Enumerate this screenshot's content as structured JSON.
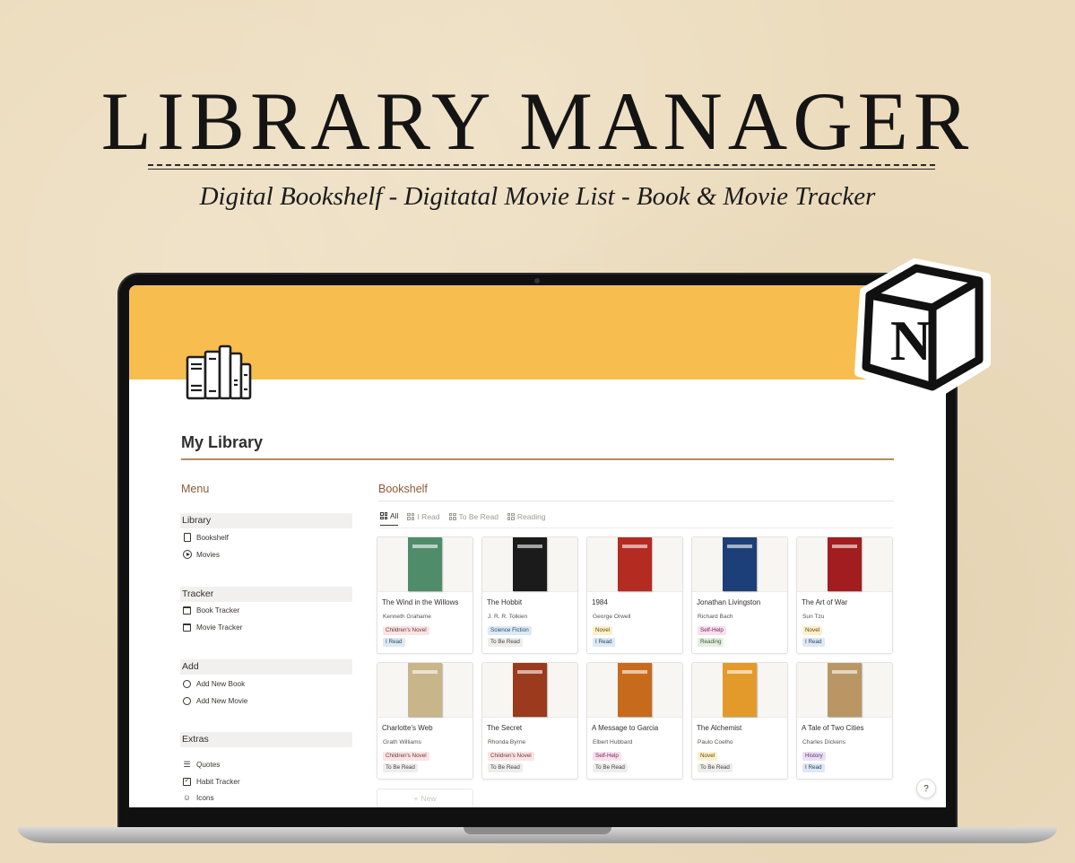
{
  "hero": {
    "title": "LIBRARY MANAGER",
    "subtitle": "Digital Bookshelf - Digitatal Movie List  - Book & Movie Tracker"
  },
  "notion_logo": {
    "letter": "N"
  },
  "colors": {
    "cover": "#f7bd4e",
    "accent_brown": "#8c5a3a",
    "tags": {
      "children": {
        "bg": "#fbe4e4",
        "fg": "#6b3a3a"
      },
      "novel": {
        "bg": "#fbf0c9",
        "fg": "#5c4a1e"
      },
      "science": {
        "bg": "#dbeaf6",
        "fg": "#2e4c66"
      },
      "selfhelp": {
        "bg": "#f9e0ef",
        "fg": "#6b2c51"
      },
      "history": {
        "bg": "#ecdff5",
        "fg": "#533565"
      },
      "iread": {
        "bg": "#dde9f3",
        "fg": "#2a4a63"
      },
      "toberead": {
        "bg": "#eeedeb",
        "fg": "#45433f"
      },
      "reading": {
        "bg": "#e3f0e0",
        "fg": "#3b5a35"
      }
    }
  },
  "page": {
    "icon": "books-icon",
    "title": "My Library"
  },
  "sidebar": {
    "heading": "Menu",
    "sections": [
      {
        "label": "Library",
        "items": [
          {
            "label": "Bookshelf",
            "icon": "book-icon"
          },
          {
            "label": "Movies",
            "icon": "play-icon"
          }
        ]
      },
      {
        "label": "Tracker",
        "items": [
          {
            "label": "Book Tracker",
            "icon": "calendar-icon"
          },
          {
            "label": "Movie Tracker",
            "icon": "calendar-icon"
          }
        ]
      },
      {
        "label": "Add",
        "items": [
          {
            "label": "Add New Book",
            "icon": "circle-icon"
          },
          {
            "label": "Add New Movie",
            "icon": "circle-icon"
          }
        ]
      },
      {
        "label": "Extras",
        "items": [
          {
            "label": "Quotes",
            "icon": "list-icon"
          },
          {
            "label": "Habit Tracker",
            "icon": "checkbox-icon"
          },
          {
            "label": "Icons",
            "icon": "smile-icon"
          }
        ]
      }
    ]
  },
  "bookshelf": {
    "heading": "Bookshelf",
    "tabs": [
      "All",
      "I Read",
      "To Be Read",
      "Reading"
    ],
    "active_tab": "All",
    "new_label": "New",
    "help_label": "?",
    "books": [
      {
        "title": "The Wind in the Willows",
        "author": "Kenneth Grahame",
        "genre": "Children's Novel",
        "genre_key": "children",
        "status": "I Read",
        "status_key": "iread",
        "cover": "#4f8d6a"
      },
      {
        "title": "The Hobbit",
        "author": "J. R. R. Tolkien",
        "genre": "Science Fiction",
        "genre_key": "science",
        "status": "To Be Read",
        "status_key": "toberead",
        "cover": "#1b1b1b"
      },
      {
        "title": "1984",
        "author": "George Orwell",
        "genre": "Novel",
        "genre_key": "novel",
        "status": "I Read",
        "status_key": "iread",
        "cover": "#b42b22"
      },
      {
        "title": "Jonathan Livingston",
        "author": "Richard Bach",
        "genre": "Self-Help",
        "genre_key": "selfhelp",
        "status": "Reading",
        "status_key": "reading",
        "cover": "#1d3f78"
      },
      {
        "title": "The Art of War",
        "author": "Sun Tzu",
        "genre": "Novel",
        "genre_key": "novel",
        "status": "I Read",
        "status_key": "iread",
        "cover": "#a11d1f"
      },
      {
        "title": "Charlotte's Web",
        "author": "Grath Williams",
        "genre": "Children's Novel",
        "genre_key": "children",
        "status": "To Be Read",
        "status_key": "toberead",
        "cover": "#c9b58a"
      },
      {
        "title": "The Secret",
        "author": "Rhonda Byrne",
        "genre": "Children's Novel",
        "genre_key": "children",
        "status": "To Be Read",
        "status_key": "toberead",
        "cover": "#9b3a1c"
      },
      {
        "title": "A Message to Garcia",
        "author": "Elbert Hubbard",
        "genre": "Self-Help",
        "genre_key": "selfhelp",
        "status": "To Be Read",
        "status_key": "toberead",
        "cover": "#c86a1c"
      },
      {
        "title": "The Alchemist",
        "author": "Paulo Coelho",
        "genre": "Novel",
        "genre_key": "novel",
        "status": "To Be Read",
        "status_key": "toberead",
        "cover": "#e39a2a"
      },
      {
        "title": "A Tale of Two Cities",
        "author": "Charles Dickens",
        "genre": "History",
        "genre_key": "history",
        "status": "I Read",
        "status_key": "iread",
        "cover": "#b99664"
      }
    ]
  }
}
